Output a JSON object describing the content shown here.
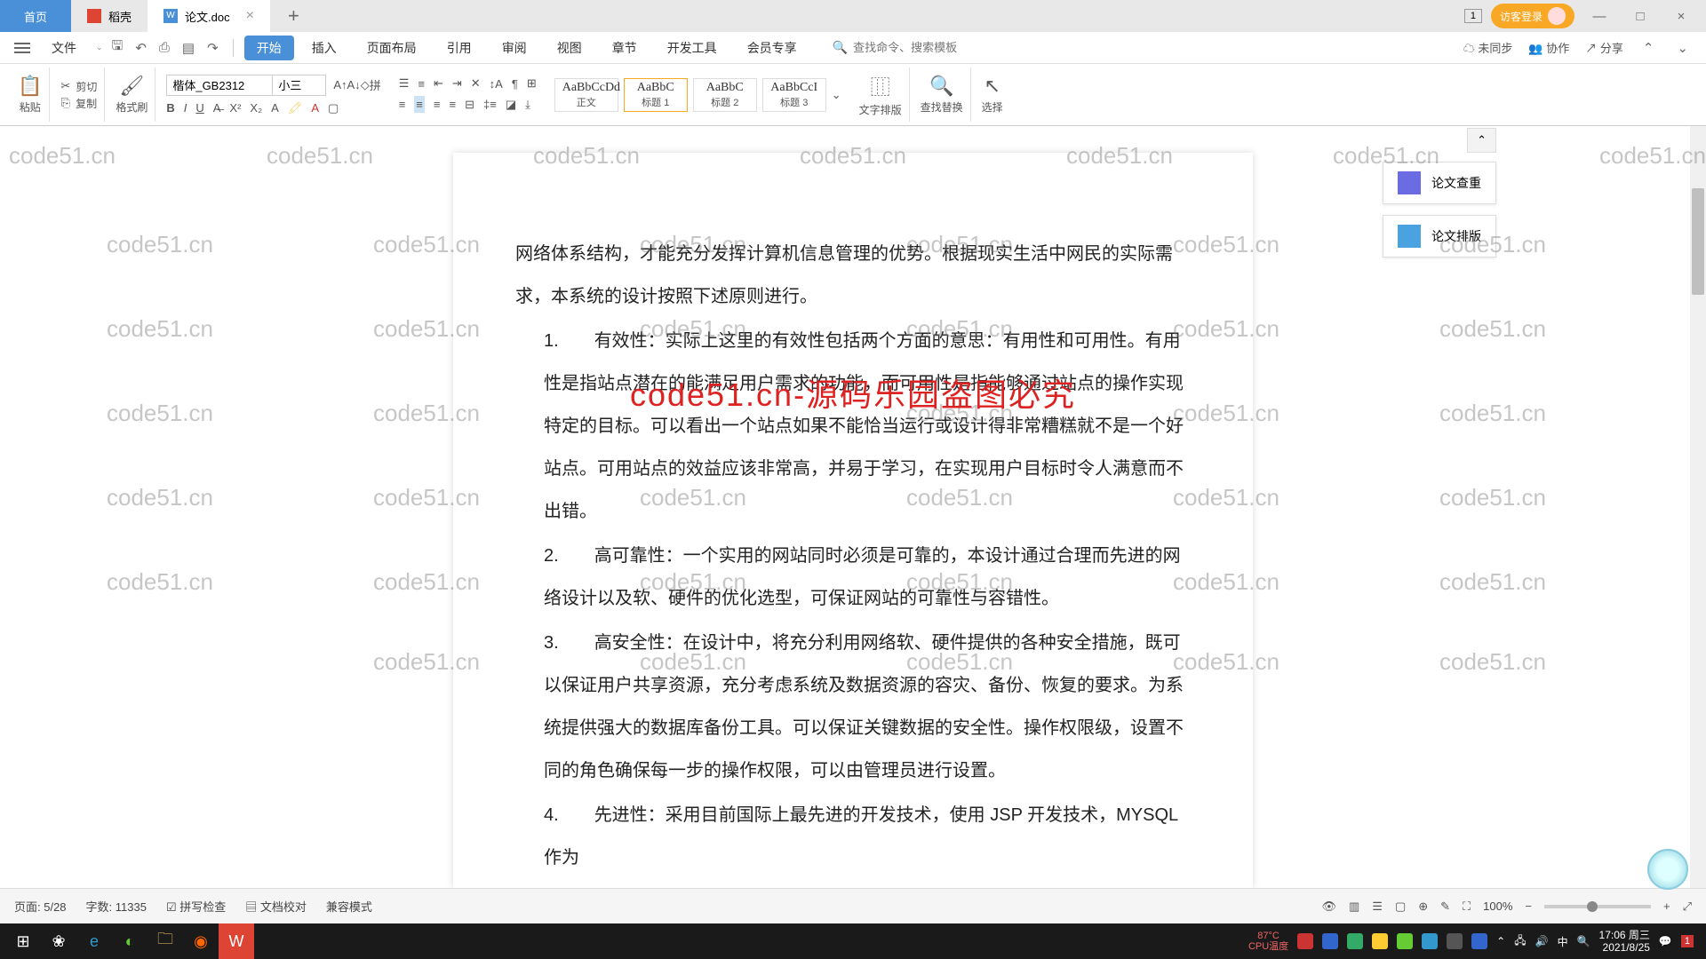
{
  "tabs": {
    "home": "首页",
    "daoke": "稻壳",
    "doc": "论文.doc"
  },
  "titlebar": {
    "badge": "1",
    "login": "访客登录"
  },
  "menu": {
    "file": "文件",
    "start": "开始",
    "insert": "插入",
    "layout": "页面布局",
    "ref": "引用",
    "review": "审阅",
    "view": "视图",
    "chapter": "章节",
    "devtools": "开发工具",
    "member": "会员专享",
    "search_placeholder": "查找命令、搜索模板",
    "unsync": "未同步",
    "collab": "协作",
    "share": "分享"
  },
  "ribbon": {
    "paste": "粘贴",
    "cut": "剪切",
    "copy": "复制",
    "format_painter": "格式刷",
    "font_name": "楷体_GB2312",
    "font_size": "小三",
    "styles": [
      {
        "preview": "AaBbCcDd",
        "label": "正文"
      },
      {
        "preview": "AaBbC",
        "label": "标题 1"
      },
      {
        "preview": "AaBbC",
        "label": "标题 2"
      },
      {
        "preview": "AaBbCcI",
        "label": "标题 3"
      }
    ],
    "text_layout": "文字排版",
    "find_replace": "查找替换",
    "select": "选择"
  },
  "side": {
    "collapse": "⌃",
    "check": "论文查重",
    "layout": "论文排版"
  },
  "document": {
    "p0": "网络体系结构，才能充分发挥计算机信息管理的优势。根据现实生活中网民的实际需求，本系统的设计按照下述原则进行。",
    "p1_num": "1.",
    "p1": "有效性：实际上这里的有效性包括两个方面的意思：有用性和可用性。有用性是指站点潜在的能满足用户需求的功能，而可用性是指能够通过站点的操作实现特定的目标。可以看出一个站点如果不能恰当运行或设计得非常糟糕就不是一个好站点。可用站点的效益应该非常高，并易于学习，在实现用户目标时令人满意而不出错。",
    "p2_num": "2.",
    "p2": "高可靠性：一个实用的网站同时必须是可靠的，本设计通过合理而先进的网络设计以及软、硬件的优化选型，可保证网站的可靠性与容错性。",
    "p3_num": "3.",
    "p3": "高安全性：在设计中，将充分利用网络软、硬件提供的各种安全措施，既可以保证用户共享资源，充分考虑系统及数据资源的容灾、备份、恢复的要求。为系统提供强大的数据库备份工具。可以保证关键数据的安全性。操作权限级，设置不同的角色确保每一步的操作权限，可以由管理员进行设置。",
    "p4_num": "4.",
    "p4": "先进性：采用目前国际上最先进的开发技术，使用 JSP 开发技术，MYSQL 作为"
  },
  "watermark": {
    "text": "code51.cn",
    "big": "code51.cn-源码乐园盗图必究"
  },
  "status": {
    "page": "页面: 5/28",
    "words": "字数: 11335",
    "spell": "拼写检查",
    "doccheck": "文档校对",
    "compat": "兼容模式",
    "zoom": "100%"
  },
  "taskbar": {
    "temp_val": "87°C",
    "temp_label": "CPU温度",
    "time": "17:06 周三",
    "date": "2021/8/25",
    "notif": "1"
  }
}
